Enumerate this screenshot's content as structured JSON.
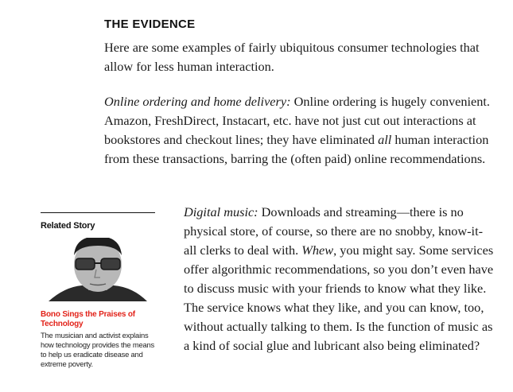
{
  "article": {
    "heading": "THE EVIDENCE",
    "intro": "Here are some examples of fairly ubiquitous consumer technologies that allow for less human interaction.",
    "online": {
      "lead": "Online ordering and home delivery:",
      "text_before": " Online ordering is hugely convenient. Amazon, FreshDirect, Instacart, etc. have not just cut out interactions at bookstores and checkout lines; they have eliminated ",
      "emphasis": "all",
      "text_after": " human interaction from these transactions, barring the (often paid) online recommendations."
    },
    "music": {
      "lead": "Digital music:",
      "text_before": " Downloads and streaming—there is no physical store, of course, so there are no snobby, know-it-all clerks to deal with. ",
      "emphasis": "Whew",
      "text_after": ", you might say. Some services offer algorithmic recommendations, so you don’t even have to discuss music with your friends to know what they like. The service knows what they like, and you can know, too, without actually talking to them. Is the function of music as a kind of social glue and lubricant also being eliminated?"
    }
  },
  "related": {
    "label": "Related Story",
    "title": "Bono Sings the Praises of Technology",
    "description": "The musician and activist explains how technology provides the means to help us eradicate disease and extreme poverty.",
    "accent_color": "#e2231a"
  }
}
